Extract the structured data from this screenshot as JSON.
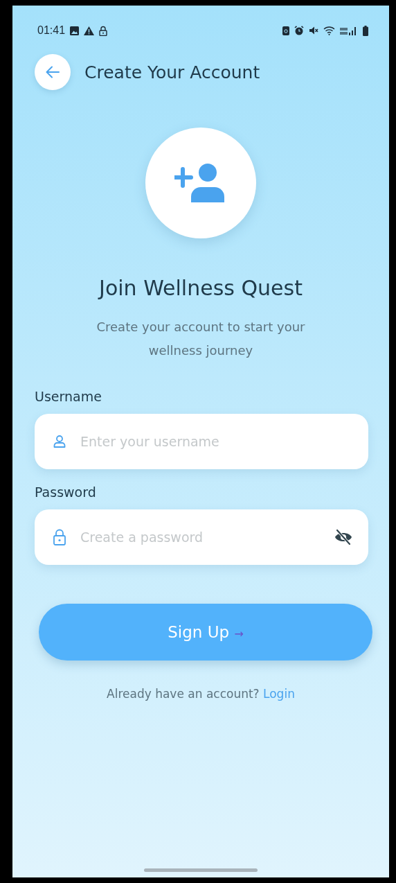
{
  "status_bar": {
    "time": "01:41"
  },
  "header": {
    "title": "Create Your Account"
  },
  "hero": {
    "title": "Join Wellness Quest",
    "subtitle": "Create your account to start your wellness journey"
  },
  "fields": [
    {
      "label": "Username",
      "placeholder": "Enter your username",
      "kind": "text"
    },
    {
      "label": "Password",
      "placeholder": "Create a password",
      "kind": "password"
    }
  ],
  "submit": {
    "label": "Sign Up",
    "arrow": "→"
  },
  "footer": {
    "prompt": "Already have an account?",
    "link": "Login"
  }
}
